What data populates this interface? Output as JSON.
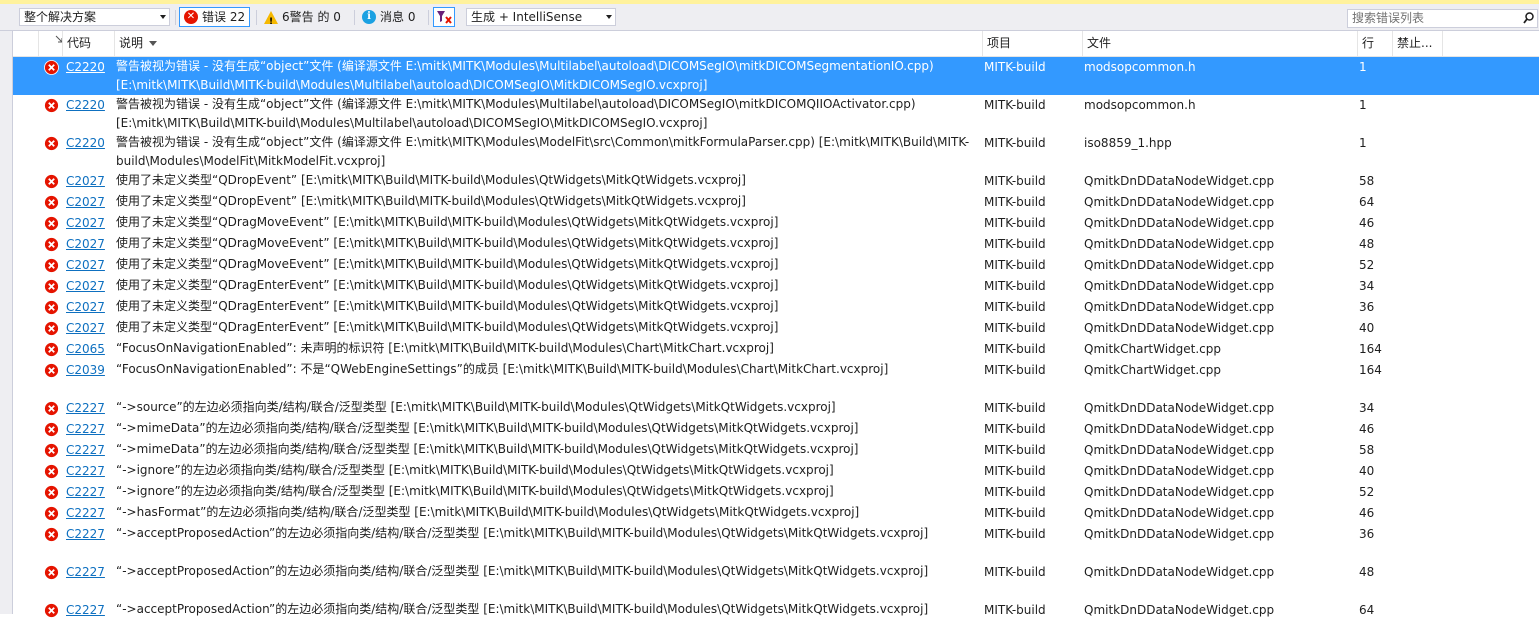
{
  "toolbar": {
    "scope": "整个解决方案",
    "errors_label": "错误 22",
    "warnings_label": "6警告 的 0",
    "messages_label": "消息 0",
    "build_filter": "生成 + IntelliSense",
    "search_placeholder": "搜索错误列表"
  },
  "columns": {
    "code": "代码",
    "description": "说明",
    "project": "项目",
    "file": "文件",
    "line": "行",
    "suppress": "禁止..."
  },
  "rows": [
    {
      "code": "C2220",
      "desc": "警告被视为错误 - 没有生成“object”文件 (编译源文件 E:\\mitk\\MITK\\Modules\\Multilabel\\autoload\\DICOMSegIO\\mitkDICOMSegmentationIO.cpp) [E:\\mitk\\MITK\\Build\\MITK-build\\Modules\\Multilabel\\autoload\\DICOMSegIO\\MitkDICOMSegIO.vcxproj]",
      "project": "MITK-build",
      "file": "modsopcommon.h",
      "line": "1"
    },
    {
      "code": "C2220",
      "desc": "警告被视为错误 - 没有生成“object”文件 (编译源文件 E:\\mitk\\MITK\\Modules\\Multilabel\\autoload\\DICOMSegIO\\mitkDICOMQIIOActivator.cpp) [E:\\mitk\\MITK\\Build\\MITK-build\\Modules\\Multilabel\\autoload\\DICOMSegIO\\MitkDICOMSegIO.vcxproj]",
      "project": "MITK-build",
      "file": "modsopcommon.h",
      "line": "1"
    },
    {
      "code": "C2220",
      "desc": "警告被视为错误 - 没有生成“object”文件 (编译源文件 E:\\mitk\\MITK\\Modules\\ModelFit\\src\\Common\\mitkFormulaParser.cpp) [E:\\mitk\\MITK\\Build\\MITK-build\\Modules\\ModelFit\\MitkModelFit.vcxproj]",
      "project": "MITK-build",
      "file": "iso8859_1.hpp",
      "line": "1"
    },
    {
      "code": "C2027",
      "desc": "使用了未定义类型“QDropEvent” [E:\\mitk\\MITK\\Build\\MITK-build\\Modules\\QtWidgets\\MitkQtWidgets.vcxproj]",
      "project": "MITK-build",
      "file": "QmitkDnDDataNodeWidget.cpp",
      "line": "58"
    },
    {
      "code": "C2027",
      "desc": "使用了未定义类型“QDropEvent” [E:\\mitk\\MITK\\Build\\MITK-build\\Modules\\QtWidgets\\MitkQtWidgets.vcxproj]",
      "project": "MITK-build",
      "file": "QmitkDnDDataNodeWidget.cpp",
      "line": "64"
    },
    {
      "code": "C2027",
      "desc": "使用了未定义类型“QDragMoveEvent” [E:\\mitk\\MITK\\Build\\MITK-build\\Modules\\QtWidgets\\MitkQtWidgets.vcxproj]",
      "project": "MITK-build",
      "file": "QmitkDnDDataNodeWidget.cpp",
      "line": "46"
    },
    {
      "code": "C2027",
      "desc": "使用了未定义类型“QDragMoveEvent” [E:\\mitk\\MITK\\Build\\MITK-build\\Modules\\QtWidgets\\MitkQtWidgets.vcxproj]",
      "project": "MITK-build",
      "file": "QmitkDnDDataNodeWidget.cpp",
      "line": "48"
    },
    {
      "code": "C2027",
      "desc": "使用了未定义类型“QDragMoveEvent” [E:\\mitk\\MITK\\Build\\MITK-build\\Modules\\QtWidgets\\MitkQtWidgets.vcxproj]",
      "project": "MITK-build",
      "file": "QmitkDnDDataNodeWidget.cpp",
      "line": "52"
    },
    {
      "code": "C2027",
      "desc": "使用了未定义类型“QDragEnterEvent” [E:\\mitk\\MITK\\Build\\MITK-build\\Modules\\QtWidgets\\MitkQtWidgets.vcxproj]",
      "project": "MITK-build",
      "file": "QmitkDnDDataNodeWidget.cpp",
      "line": "34"
    },
    {
      "code": "C2027",
      "desc": "使用了未定义类型“QDragEnterEvent” [E:\\mitk\\MITK\\Build\\MITK-build\\Modules\\QtWidgets\\MitkQtWidgets.vcxproj]",
      "project": "MITK-build",
      "file": "QmitkDnDDataNodeWidget.cpp",
      "line": "36"
    },
    {
      "code": "C2027",
      "desc": "使用了未定义类型“QDragEnterEvent” [E:\\mitk\\MITK\\Build\\MITK-build\\Modules\\QtWidgets\\MitkQtWidgets.vcxproj]",
      "project": "MITK-build",
      "file": "QmitkDnDDataNodeWidget.cpp",
      "line": "40"
    },
    {
      "code": "C2065",
      "desc": "“FocusOnNavigationEnabled”: 未声明的标识符 [E:\\mitk\\MITK\\Build\\MITK-build\\Modules\\Chart\\MitkChart.vcxproj]",
      "project": "MITK-build",
      "file": "QmitkChartWidget.cpp",
      "line": "164"
    },
    {
      "code": "C2039",
      "desc": "“FocusOnNavigationEnabled”: 不是“QWebEngineSettings”的成员 [E:\\mitk\\MITK\\Build\\MITK-build\\Modules\\Chart\\MitkChart.vcxproj]",
      "project": "MITK-build",
      "file": "QmitkChartWidget.cpp",
      "line": "164"
    },
    {
      "code": "C2227",
      "desc": "“->source”的左边必须指向类/结构/联合/泛型类型 [E:\\mitk\\MITK\\Build\\MITK-build\\Modules\\QtWidgets\\MitkQtWidgets.vcxproj]",
      "project": "MITK-build",
      "file": "QmitkDnDDataNodeWidget.cpp",
      "line": "34"
    },
    {
      "code": "C2227",
      "desc": "“->mimeData”的左边必须指向类/结构/联合/泛型类型 [E:\\mitk\\MITK\\Build\\MITK-build\\Modules\\QtWidgets\\MitkQtWidgets.vcxproj]",
      "project": "MITK-build",
      "file": "QmitkDnDDataNodeWidget.cpp",
      "line": "46"
    },
    {
      "code": "C2227",
      "desc": "“->mimeData”的左边必须指向类/结构/联合/泛型类型 [E:\\mitk\\MITK\\Build\\MITK-build\\Modules\\QtWidgets\\MitkQtWidgets.vcxproj]",
      "project": "MITK-build",
      "file": "QmitkDnDDataNodeWidget.cpp",
      "line": "58"
    },
    {
      "code": "C2227",
      "desc": "“->ignore”的左边必须指向类/结构/联合/泛型类型 [E:\\mitk\\MITK\\Build\\MITK-build\\Modules\\QtWidgets\\MitkQtWidgets.vcxproj]",
      "project": "MITK-build",
      "file": "QmitkDnDDataNodeWidget.cpp",
      "line": "40"
    },
    {
      "code": "C2227",
      "desc": "“->ignore”的左边必须指向类/结构/联合/泛型类型 [E:\\mitk\\MITK\\Build\\MITK-build\\Modules\\QtWidgets\\MitkQtWidgets.vcxproj]",
      "project": "MITK-build",
      "file": "QmitkDnDDataNodeWidget.cpp",
      "line": "52"
    },
    {
      "code": "C2227",
      "desc": "“->hasFormat”的左边必须指向类/结构/联合/泛型类型 [E:\\mitk\\MITK\\Build\\MITK-build\\Modules\\QtWidgets\\MitkQtWidgets.vcxproj]",
      "project": "MITK-build",
      "file": "QmitkDnDDataNodeWidget.cpp",
      "line": "46"
    },
    {
      "code": "C2227",
      "desc": "“->acceptProposedAction”的左边必须指向类/结构/联合/泛型类型 [E:\\mitk\\MITK\\Build\\MITK-build\\Modules\\QtWidgets\\MitkQtWidgets.vcxproj]",
      "project": "MITK-build",
      "file": "QmitkDnDDataNodeWidget.cpp",
      "line": "36"
    },
    {
      "code": "C2227",
      "desc": "“->acceptProposedAction”的左边必须指向类/结构/联合/泛型类型 [E:\\mitk\\MITK\\Build\\MITK-build\\Modules\\QtWidgets\\MitkQtWidgets.vcxproj]",
      "project": "MITK-build",
      "file": "QmitkDnDDataNodeWidget.cpp",
      "line": "48"
    },
    {
      "code": "C2227",
      "desc": "“->acceptProposedAction”的左边必须指向类/结构/联合/泛型类型 [E:\\mitk\\MITK\\Build\\MITK-build\\Modules\\QtWidgets\\MitkQtWidgets.vcxproj]",
      "project": "MITK-build",
      "file": "QmitkDnDDataNodeWidget.cpp",
      "line": "64"
    }
  ],
  "selected_row": 0,
  "colors": {
    "accent": "#3399ff",
    "error": "#e51400",
    "link": "#0e70c0",
    "toolbar_bg": "#eeeef2"
  }
}
